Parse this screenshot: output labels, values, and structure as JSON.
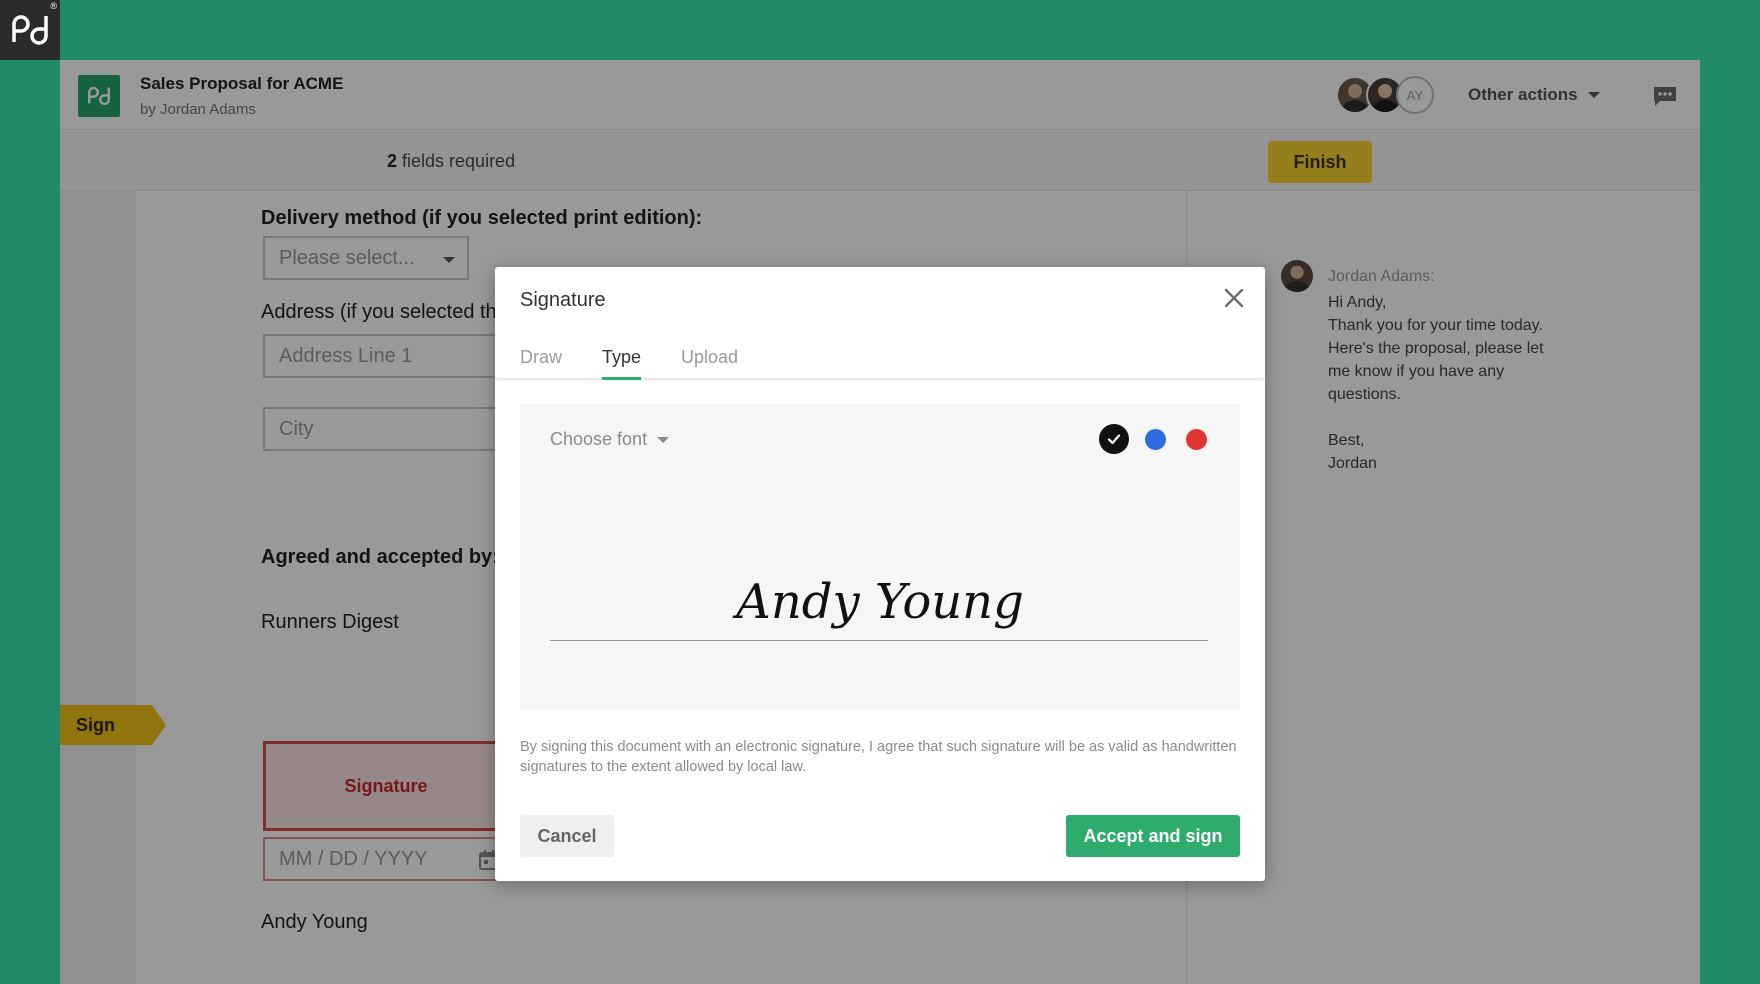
{
  "brand": {
    "logo_icon": "pandadoc-logo-icon",
    "registered_mark": "®"
  },
  "header": {
    "doc_title": "Sales Proposal for ACME",
    "doc_author": "by Jordan Adams",
    "avatar_initials": "AY",
    "other_actions_label": "Other actions"
  },
  "toolbar": {
    "fields_required_count": "2",
    "fields_required_text": " fields required",
    "finish_label": "Finish"
  },
  "document": {
    "delivery_label": "Delivery method (if you selected print edition):",
    "delivery_placeholder": "Please select...",
    "address_label": "Address (if you selected the doo",
    "address_line1_placeholder": "Address Line 1",
    "city_placeholder": "City",
    "agreed_label": "Agreed and accepted by:",
    "company_name": "Runners Digest",
    "sign_flag_label": "Sign",
    "signature_field_label": "Signature",
    "date_placeholder": "MM / DD / YYYY",
    "signer_name": "Andy Young"
  },
  "comment": {
    "author": "Jordan Adams:",
    "lines": [
      "Hi Andy,",
      "Thank you for your time today.",
      "Here's the proposal, please let",
      "me know if you have any",
      "questions.",
      "",
      "Best,",
      "Jordan"
    ]
  },
  "modal": {
    "title": "Signature",
    "tabs": [
      {
        "label": "Draw",
        "active": false
      },
      {
        "label": "Type",
        "active": true
      },
      {
        "label": "Upload",
        "active": false
      }
    ],
    "choose_font_label": "Choose font",
    "colors": {
      "black": "#111111",
      "blue": "#2d6be0",
      "red": "#e03535",
      "selected": "black"
    },
    "typed_signature": "Andy Young",
    "legal_text": "By signing this document with an electronic signature, I agree that such signature will be as valid as handwritten signatures to the extent allowed by local law.",
    "cancel_label": "Cancel",
    "accept_label": "Accept and sign"
  },
  "colors": {
    "page_bg": "#228a69",
    "accent_green": "#2dac6d",
    "finish_yellow": "#f8d230",
    "signature_red": "#d94a4a"
  }
}
